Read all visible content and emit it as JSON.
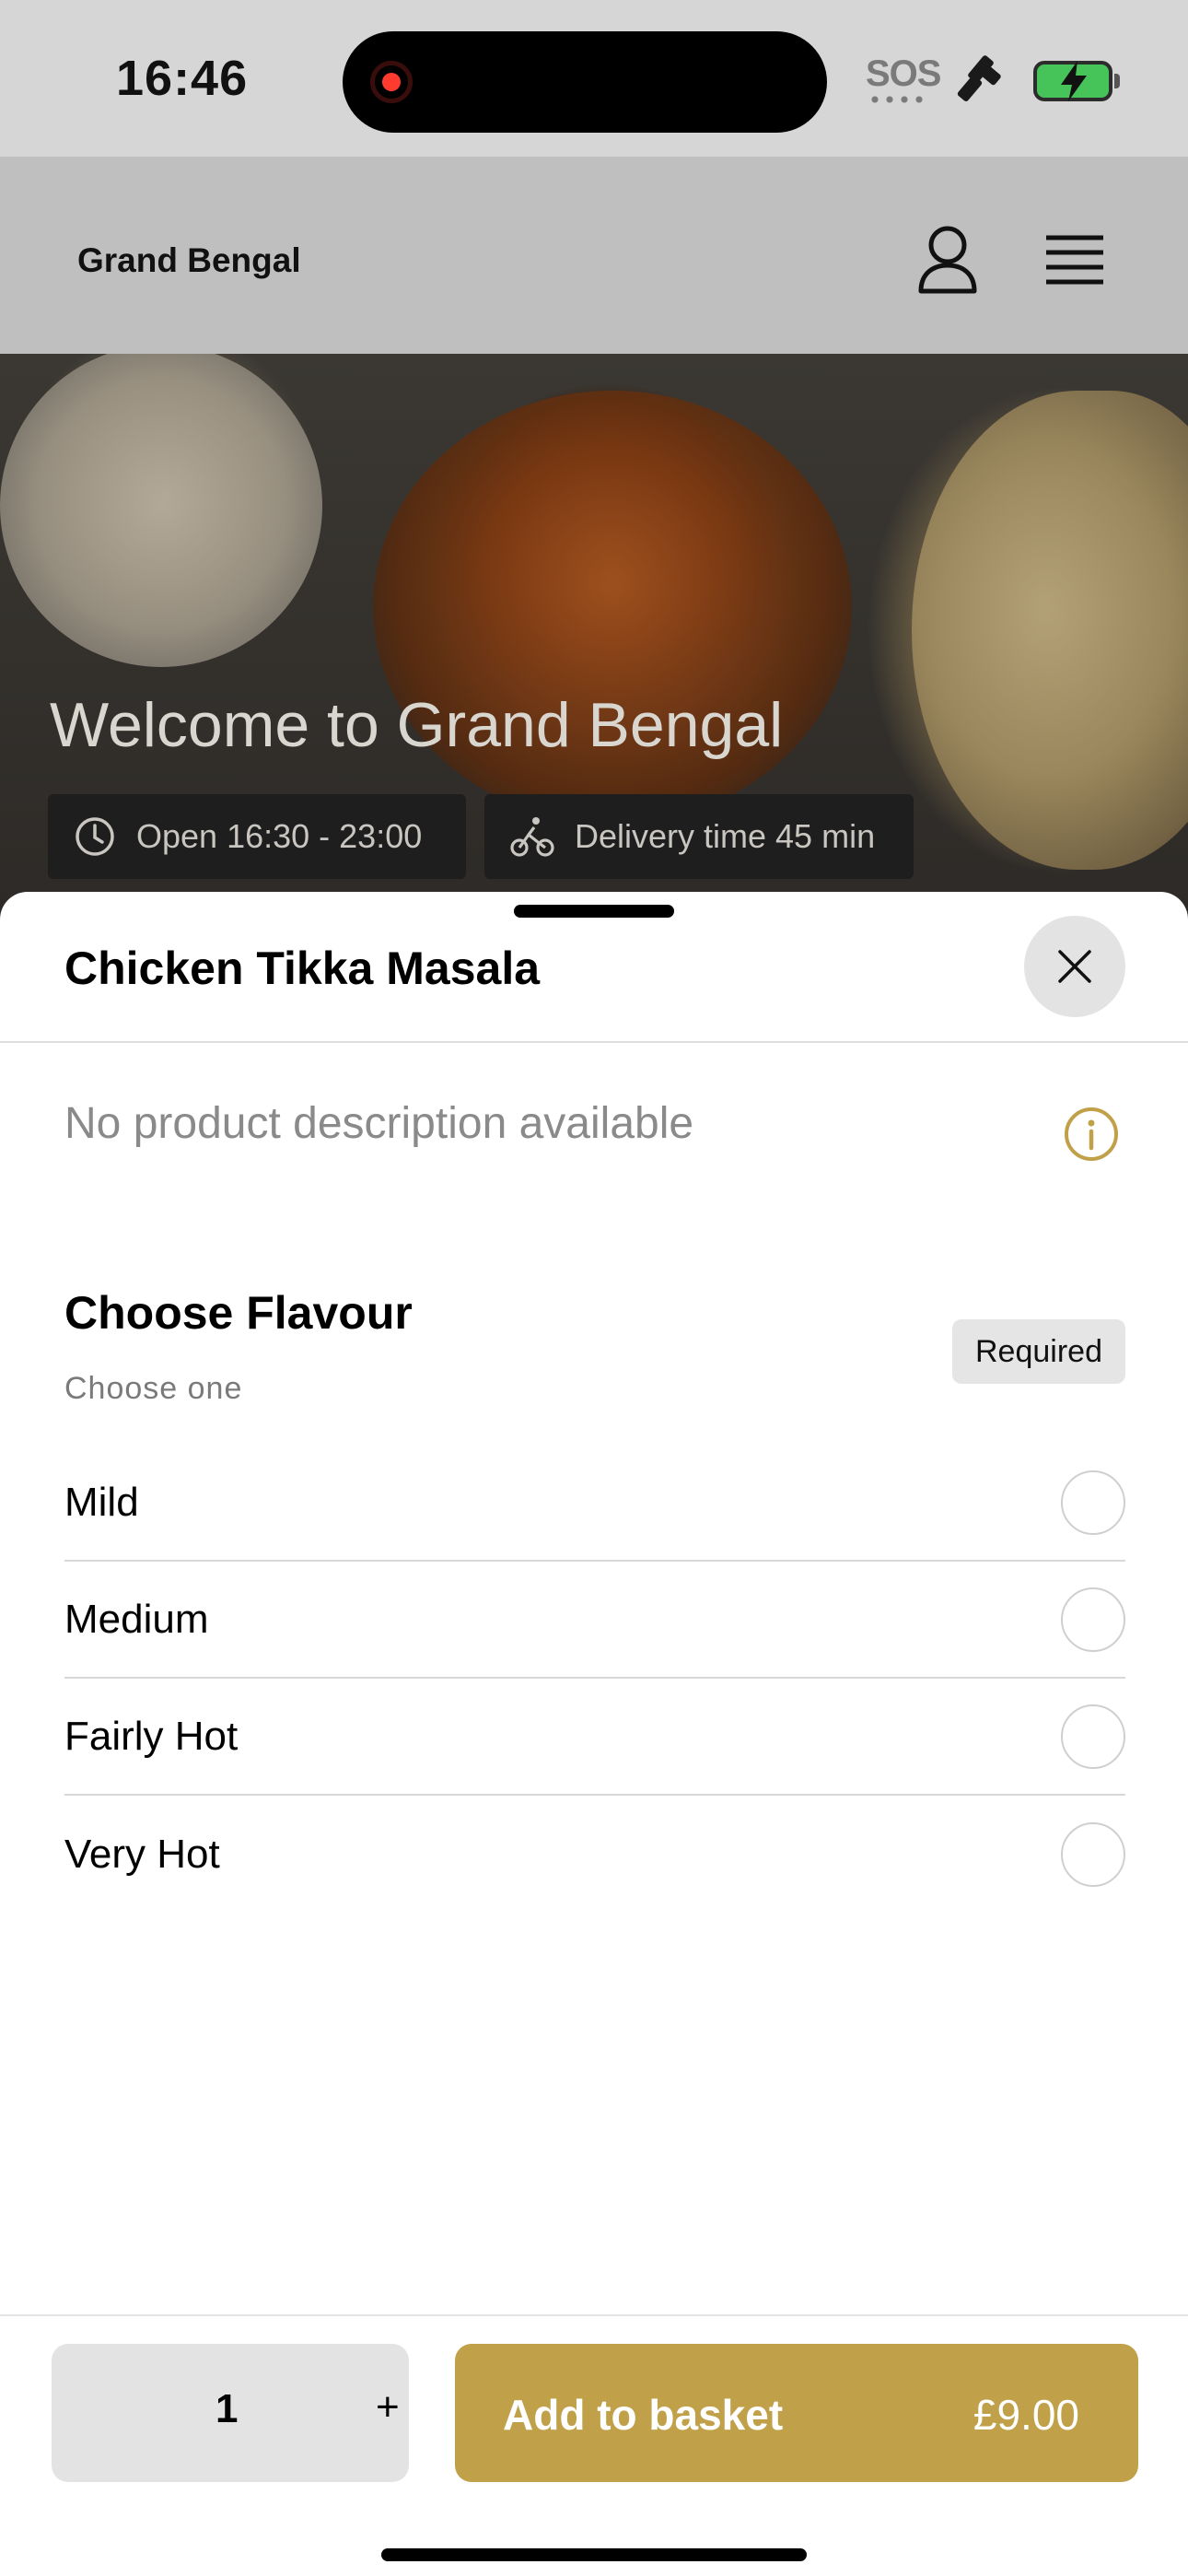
{
  "status_bar": {
    "time": "16:46",
    "sos_label": "SOS",
    "icons": [
      "screen-recording-icon",
      "satellite-icon",
      "battery-charging-icon"
    ],
    "battery_color": "#46c45a"
  },
  "header": {
    "brand": "Grand Bengal",
    "icons": [
      "user-icon",
      "menu-icon"
    ]
  },
  "hero": {
    "title": "Welcome to Grand Bengal",
    "open_hours": "Open 16:30 - 23:00",
    "delivery_time": "Delivery time 45 min"
  },
  "product_sheet": {
    "title": "Chicken Tikka Masala",
    "description": "No product description available",
    "flavour_section": {
      "title": "Choose Flavour",
      "subtitle": "Choose one",
      "badge": "Required",
      "options": [
        {
          "label": "Mild",
          "selected": false
        },
        {
          "label": "Medium",
          "selected": false
        },
        {
          "label": "Fairly Hot",
          "selected": false
        },
        {
          "label": "Very Hot",
          "selected": false
        }
      ]
    }
  },
  "footer": {
    "quantity": "1",
    "plus_label": "+",
    "add_label": "Add to basket",
    "price": "£9.00",
    "accent_color": "#c0a048"
  }
}
